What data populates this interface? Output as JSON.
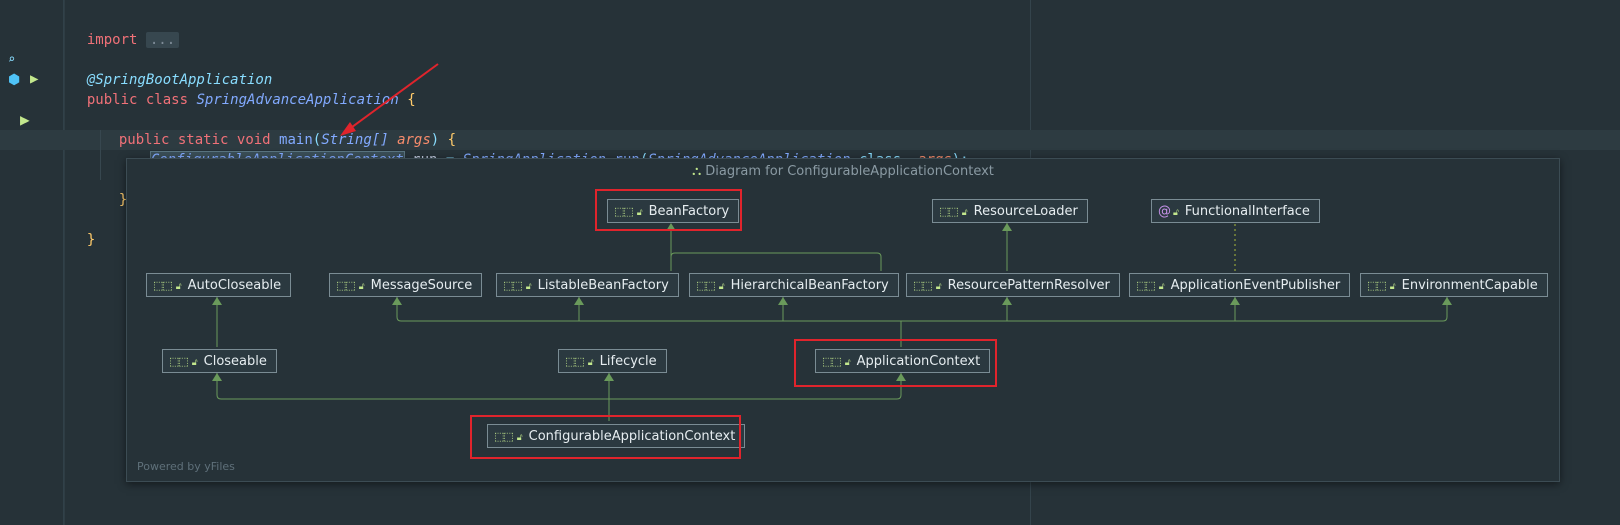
{
  "editor": {
    "import_kw": "import",
    "import_folded": "...",
    "annotation": "@SpringBootApplication",
    "public_kw": "public",
    "class_kw": "class",
    "class_name": "SpringAdvanceApplication",
    "brace_open": "{",
    "static_kw": "static",
    "void_kw": "void",
    "main_name": "main",
    "string_type": "String[]",
    "args_param": "args",
    "ctx_type": "ConfigurableApplicationContext",
    "var_name": "run",
    "assign": "=",
    "spring_app": "SpringApplication",
    "run_method": "run",
    "class_ref": "SpringAdvanceApplication",
    "dot_class": ".class,",
    "args_arg": "args",
    "close_paren": ");",
    "inner_close": "}",
    "outer_close": "}"
  },
  "gutter": {
    "search_icon": "search-icon",
    "bean_icon": "bean-icon",
    "run_icon": "run-icon"
  },
  "diagram": {
    "title": "Diagram for ConfigurableApplicationContext",
    "title_icon": "hierarchy-icon",
    "powered_by": "Powered by yFiles",
    "nodes": {
      "bean_factory": "BeanFactory",
      "resource_loader": "ResourceLoader",
      "functional_interface": "FunctionalInterface",
      "auto_closeable": "AutoCloseable",
      "message_source": "MessageSource",
      "listable_bean_factory": "ListableBeanFactory",
      "hierarchical_bean_factory": "HierarchicalBeanFactory",
      "resource_pattern_resolver": "ResourcePatternResolver",
      "application_event_publisher": "ApplicationEventPublisher",
      "environment_capable": "EnvironmentCapable",
      "closeable": "Closeable",
      "lifecycle": "Lifecycle",
      "application_context": "ApplicationContext",
      "configurable_application_context": "ConfigurableApplicationContext"
    }
  },
  "colors": {
    "highlight_box": "#e0242c",
    "edge": "#6a9a5b",
    "background": "#263238"
  }
}
